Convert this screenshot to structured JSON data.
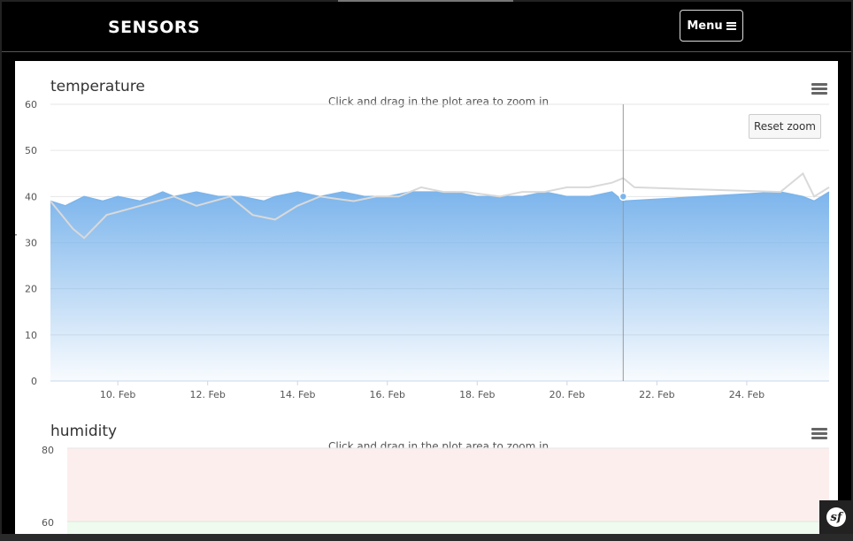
{
  "navbar": {
    "brand": "SENSORS",
    "menu_label": "Menu",
    "menu_icon": "hamburger-icon"
  },
  "charts_ui": {
    "zoom_hint": "Click and drag in the plot area to zoom in",
    "reset_zoom": "Reset zoom",
    "context_menu_icon": "hamburger-menu-icon"
  },
  "colors": {
    "area_top": "#7cb5ec",
    "series_main": "#90b8e4",
    "series_secondary": "#dddddd",
    "grid": "#e6e6e6",
    "humidity_band_high": "#fdeeee",
    "humidity_band_ok": "#eefbee"
  },
  "chart_data": [
    {
      "type": "area",
      "title": "temperature",
      "ylabel": "temperature",
      "ylim": [
        0,
        60
      ],
      "yticks": [
        "0",
        "10",
        "20",
        "30",
        "40",
        "50",
        "60"
      ],
      "xlim": [
        "2018-02-08 12:00",
        "2018-02-25 20:00"
      ],
      "xticks": [
        "10. Feb",
        "12. Feb",
        "14. Feb",
        "16. Feb",
        "18. Feb",
        "20. Feb",
        "22. Feb",
        "24. Feb"
      ],
      "crosshair_x": "2018-02-21 06:00",
      "highlight_point": {
        "x": "2018-02-21 06:00",
        "y": 40
      },
      "series": [
        {
          "values_x": [
            "08 12:00",
            "08 20:00",
            "09 06:00",
            "09 16:00",
            "10 00:00",
            "10 12:00",
            "11 00:00",
            "11 06:00",
            "11 18:00",
            "12 06:00",
            "12 18:00",
            "13 06:00",
            "13 12:00",
            "14 00:00",
            "14 12:00",
            "15 00:00",
            "15 12:00",
            "16 00:00",
            "16 12:00",
            "17 00:00",
            "17 12:00",
            "18 00:00",
            "18 12:00",
            "19 00:00",
            "19 12:00",
            "20 00:00",
            "20 12:00",
            "21 00:00",
            "21 06:00",
            "24 18:00",
            "25 06:00",
            "25 12:00",
            "25 20:00"
          ],
          "values": [
            39,
            38,
            40,
            39,
            40,
            39,
            41,
            40,
            41,
            40,
            40,
            39,
            40,
            41,
            40,
            41,
            40,
            40,
            41,
            41,
            41,
            40,
            40,
            40,
            41,
            40,
            40,
            41,
            39,
            41,
            40,
            39,
            41
          ]
        },
        {
          "values_x": [
            "08 12:00",
            "09 00:00",
            "09 06:00",
            "09 18:00",
            "10 12:00",
            "11 06:00",
            "11 18:00",
            "12 12:00",
            "13 00:00",
            "13 12:00",
            "14 00:00",
            "14 12:00",
            "15 06:00",
            "15 18:00",
            "16 06:00",
            "16 18:00",
            "17 06:00",
            "17 18:00",
            "18 12:00",
            "19 00:00",
            "19 12:00",
            "20 00:00",
            "20 12:00",
            "21 00:00",
            "21 06:00",
            "21 12:00",
            "24 18:00",
            "25 06:00",
            "25 12:00",
            "25 20:00"
          ],
          "values": [
            39,
            33,
            31,
            36,
            38,
            40,
            38,
            40,
            36,
            35,
            38,
            40,
            39,
            40,
            40,
            42,
            41,
            41,
            40,
            41,
            41,
            42,
            42,
            43,
            44,
            42,
            41,
            45,
            40,
            42
          ]
        }
      ]
    },
    {
      "type": "area",
      "title": "humidity",
      "ylim": [
        60,
        80
      ],
      "yticks": [
        "60",
        "80"
      ],
      "bands": [
        {
          "from": 60,
          "to": 80,
          "color": "#fdeeee"
        }
      ]
    }
  ]
}
